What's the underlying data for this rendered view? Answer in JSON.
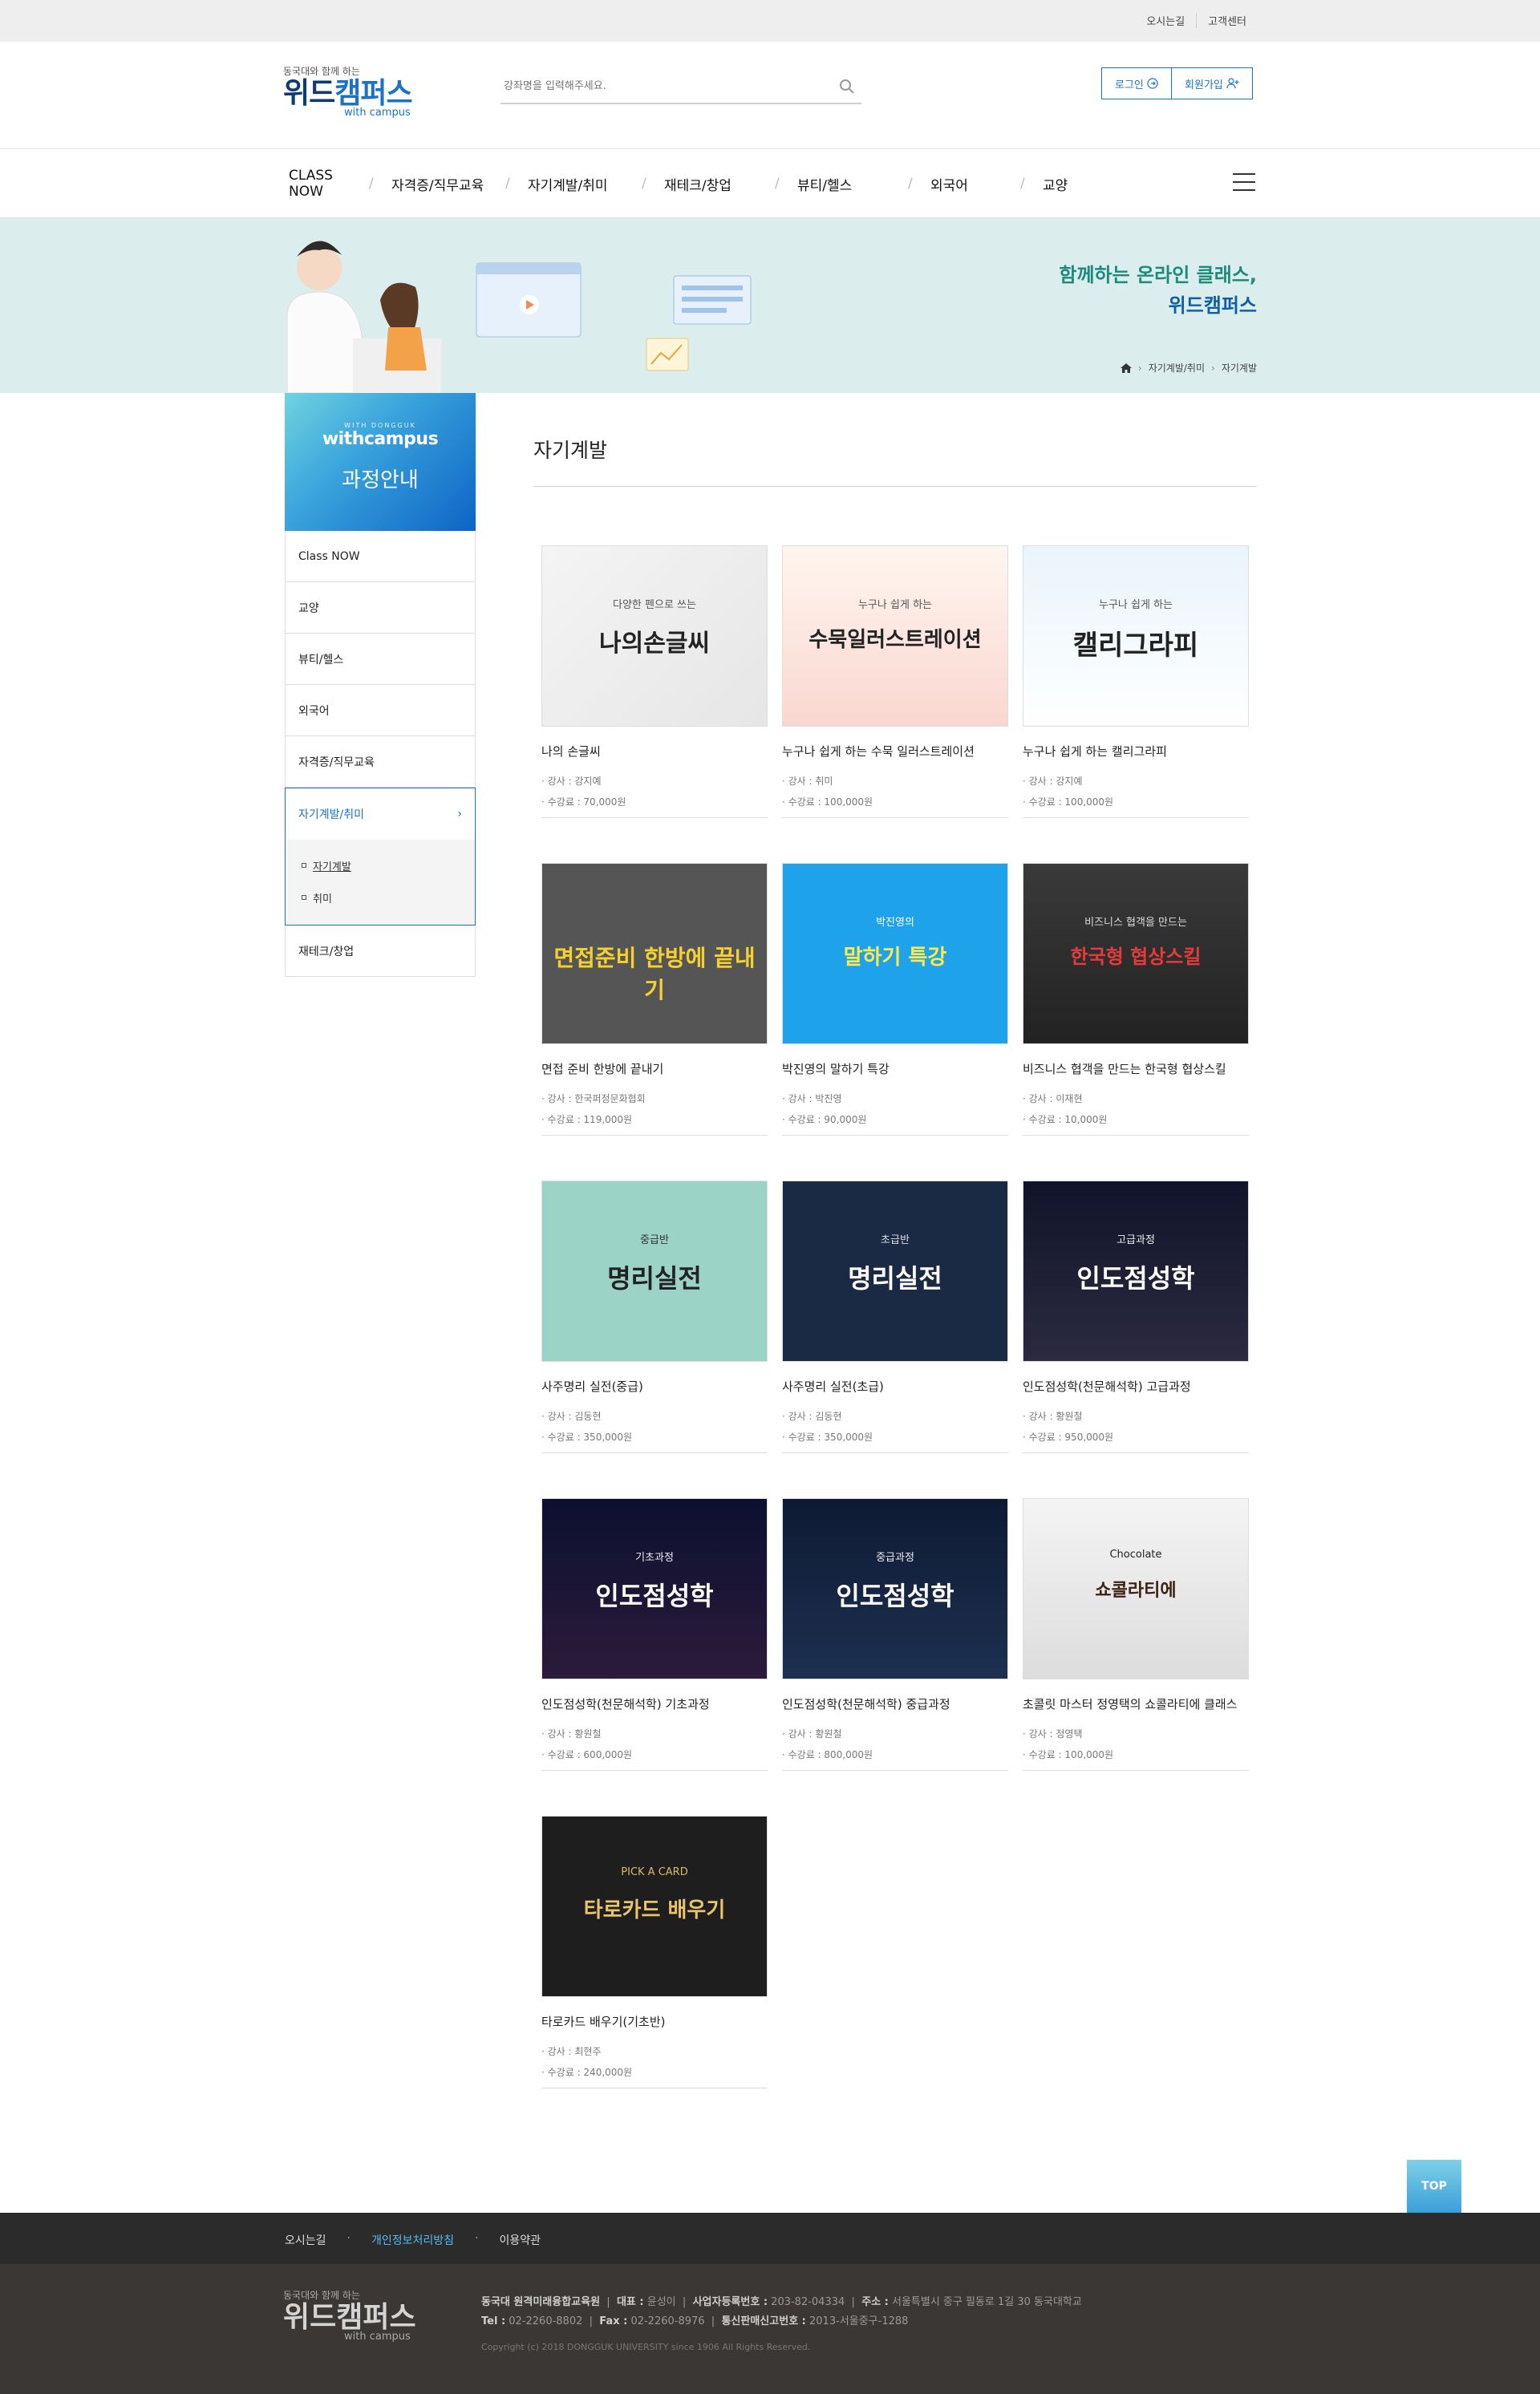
{
  "topbar": {
    "directions": "오시는길",
    "support": "고객센터"
  },
  "logo": {
    "sub": "동국대와 함께 하는",
    "main_a": "위드",
    "main_b": "캠퍼스",
    "en": "with campus"
  },
  "search": {
    "placeholder": "강좌명을 입력해주세요."
  },
  "auth": {
    "login": "로그인",
    "join": "회원가입"
  },
  "gnb": {
    "items": [
      "CLASS NOW",
      "자격증/직무교육",
      "자기계발/취미",
      "재테크/창업",
      "뷰티/헬스",
      "외국어",
      "교양"
    ]
  },
  "banner": {
    "line1": "함께하는 온라인 클래스,",
    "line2": "위드캠퍼스",
    "crumb1": "자기계발/취미",
    "crumb2": "자기계발"
  },
  "side": {
    "small": "WITH DONGGUK",
    "brand": "withcampus",
    "title": "과정안내",
    "items": [
      "Class NOW",
      "교양",
      "뷰티/헬스",
      "외국어",
      "자격증/직무교육"
    ],
    "active": "자기계발/취미",
    "subs": [
      "자기계발",
      "취미"
    ],
    "last": "재테크/창업"
  },
  "content": {
    "title": "자기계발"
  },
  "courses": [
    {
      "name": "나의 손글씨",
      "teacher": "· 강사 :  강지예",
      "fee": "· 수강료 :  70,000원",
      "thumb": "나의손글씨",
      "small": "다양한 펜으로 쓰는"
    },
    {
      "name": "누구나 쉽게 하는 수묵 일러스트레이션",
      "teacher": "· 강사 :  취미",
      "fee": "· 수강료 :  100,000원",
      "thumb": "수묵일러스트레이션",
      "small": "누구나 쉽게 하는"
    },
    {
      "name": "누구나 쉽게 하는 캘리그라피",
      "teacher": "· 강사 :  강지예",
      "fee": "· 수강료 :  100,000원",
      "thumb": "캘리그라피",
      "small": "누구나 쉽게 하는"
    },
    {
      "name": "면접 준비 한방에 끝내기",
      "teacher": "· 강사 :  한국퍼정문화협회",
      "fee": "· 수강료 :  119,000원",
      "thumb": "면접준비 한방에 끝내기",
      "small": ""
    },
    {
      "name": "박진영의 말하기 특강",
      "teacher": "· 강사 :  박진영",
      "fee": "· 수강료 :  90,000원",
      "thumb": "말하기 특강",
      "small": "박진영의"
    },
    {
      "name": "비즈니스 협객을 만드는 한국형 협상스킬",
      "teacher": "· 강사 :  이재현",
      "fee": "· 수강료 :  10,000원",
      "thumb": "한국형 협상스킬",
      "small": "비즈니스 협객을 만드는"
    },
    {
      "name": "사주명리 실전(중급)",
      "teacher": "· 강사 :  김동현",
      "fee": "· 수강료 :  350,000원",
      "thumb": "명리실전",
      "small": "중급반"
    },
    {
      "name": "사주명리 실전(초급)",
      "teacher": "· 강사 :  김동현",
      "fee": "· 수강료 :  350,000원",
      "thumb": "명리실전",
      "small": "초급반"
    },
    {
      "name": "인도점성학(천문해석학) 고급과정",
      "teacher": "· 강사 :  황원철",
      "fee": "· 수강료 :  950,000원",
      "thumb": "인도점성학",
      "small": "고급과정"
    },
    {
      "name": "인도점성학(천문해석학) 기초과정",
      "teacher": "· 강사 :  황원철",
      "fee": "· 수강료 :  600,000원",
      "thumb": "인도점성학",
      "small": "기초과정"
    },
    {
      "name": "인도점성학(천문해석학) 중급과정",
      "teacher": "· 강사 :  황원철",
      "fee": "· 수강료 :  800,000원",
      "thumb": "인도점성학",
      "small": "중급과정"
    },
    {
      "name": "초콜릿 마스터 정영택의 쇼콜라티에 클래스",
      "teacher": "· 강사 :  정영택",
      "fee": "· 수강료 :  100,000원",
      "thumb": "쇼콜라티에",
      "small": "Chocolate"
    },
    {
      "name": "타로카드 배우기(기초반)",
      "teacher": "· 강사 :  최현주",
      "fee": "· 수강료 :  240,000원",
      "thumb": "타로카드 배우기",
      "small": "PICK A CARD"
    }
  ],
  "top_button": "TOP",
  "footnav": {
    "a": "오시는길",
    "b": "개인정보처리방침",
    "c": "이용약관"
  },
  "footer": {
    "l1a_label": "동국대 원격미래융합교육원",
    "l1b_label": "대표 :",
    "l1b_val": "윤성이",
    "l1c_label": "사업자등록번호 :",
    "l1c_val": "203-82-04334",
    "l1d_label": "주소 :",
    "l1d_val": "서울특별시 중구 필동로 1길 30 동국대학교",
    "l2a_label": "Tel :",
    "l2a_val": "02-2260-8802",
    "l2b_label": "Fax :",
    "l2b_val": "02-2260-8976",
    "l2c_label": "통신판매신고번호 :",
    "l2c_val": "2013-서울중구-1288",
    "copy": "Copyright (c) 2018 DONGGUK UNIVERSITY since 1906 All Rights Reserved."
  }
}
